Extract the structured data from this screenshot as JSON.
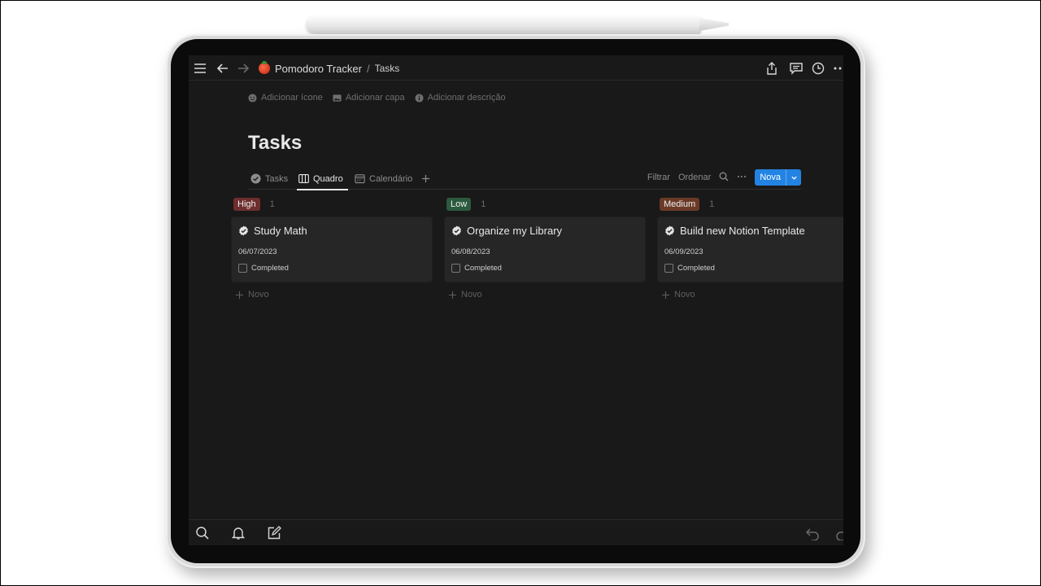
{
  "topbar": {
    "breadcrumb_parent": "Pomodoro Tracker",
    "breadcrumb_separator": "/",
    "breadcrumb_current": "Tasks"
  },
  "page_meta": {
    "add_icon": "Adicionar ícone",
    "add_cover": "Adicionar capa",
    "add_description": "Adicionar descrição"
  },
  "page": {
    "title": "Tasks"
  },
  "views": {
    "tabs": [
      {
        "label": "Tasks",
        "icon": "check-circle-icon",
        "active": false
      },
      {
        "label": "Quadro",
        "icon": "board-icon",
        "active": true
      },
      {
        "label": "Calendário",
        "icon": "calendar-icon",
        "active": false
      }
    ],
    "filter_label": "Filtrar",
    "sort_label": "Ordenar",
    "new_button_label": "Nova"
  },
  "board": {
    "columns": [
      {
        "tag": "High",
        "tag_color": "#6e2e2e",
        "count": "1",
        "cards": [
          {
            "title": "Study Math",
            "date": "06/07/2023",
            "checkbox_label": "Completed",
            "checked": false
          }
        ],
        "add_label": "Novo"
      },
      {
        "tag": "Low",
        "tag_color": "#2b5a3f",
        "count": "1",
        "cards": [
          {
            "title": "Organize my Library",
            "date": "06/08/2023",
            "checkbox_label": "Completed",
            "checked": false
          }
        ],
        "add_label": "Novo"
      },
      {
        "tag": "Medium",
        "tag_color": "#6b3a26",
        "count": "1",
        "cards": [
          {
            "title": "Build new Notion Template",
            "date": "06/09/2023",
            "checkbox_label": "Completed",
            "checked": false
          }
        ],
        "add_label": "Novo"
      }
    ]
  },
  "colors": {
    "accent": "#2383e2",
    "background": "#191919",
    "card": "#262626"
  }
}
